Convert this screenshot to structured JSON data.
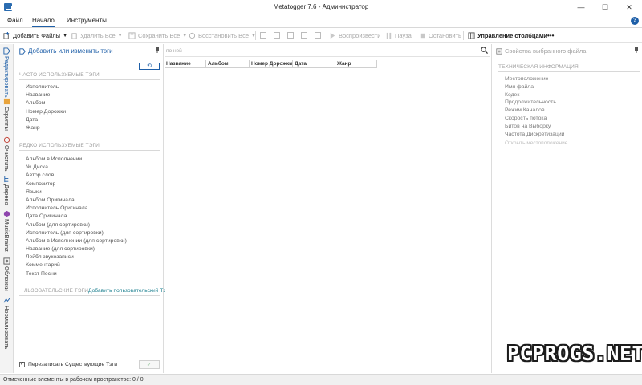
{
  "window": {
    "title": "Metatogger 7.6 - Администратор",
    "minimize_label": "—",
    "maximize_label": "☐",
    "close_label": "✕"
  },
  "menu": {
    "file": "Файл",
    "home": "Начало",
    "tools": "Инструменты",
    "help": "?"
  },
  "toolbar": {
    "add_files": "Добавить Файлы",
    "remove_all": "Удалить Всё",
    "save_all": "Сохранить Всё",
    "restore_all": "Восстановить Всё",
    "play": "Воспроизвести",
    "pause": "Пауза",
    "stop": "Остановить",
    "manage_columns": "Управление столбцами",
    "more": "•••"
  },
  "sidebar_tabs": [
    "Редактировать",
    "Скрипты",
    "Очистить",
    "Дерево",
    "MusicBrainz",
    "Обложки",
    "Нормализовать"
  ],
  "left_panel": {
    "title": "Добавить или изменить тэги",
    "refresh_label": "⟲",
    "frequent_header": "ЧАСТО ИСПОЛЬЗУЕМЫЕ ТЭГИ",
    "frequent_tags": [
      "Исполнитель",
      "Название",
      "Альбом",
      "Номер Дорожки",
      "Дата",
      "Жанр"
    ],
    "rare_header": "РЕДКО ИСПОЛЬЗУЕМЫЕ ТЭГИ",
    "rare_tags": [
      "Альбом в Исполнении",
      "№ Диска",
      "Автор слов",
      "Композитор",
      "Языки",
      "Альбом Оригинала",
      "Исполнитель Оригинала",
      "Дата Оригинала",
      "Альбом (для сортировки)",
      "Исполнитель (для сортировки)",
      "Альбом в Исполнении (для сортировки)",
      "Название (для сортировки)",
      "Лейбл звукозаписи",
      "Комментарий",
      "Текст Песни"
    ],
    "custom_header": "ЛЬЗОВАТЕЛЬСКИЕ ТЭГИ",
    "add_custom_tag": "Добавить пользовательский Тэг",
    "overwrite_label": "Перезаписать Существующие Тэги",
    "overwrite_checked": true,
    "apply_label": "✓"
  },
  "center": {
    "search_placeholder": "по ней",
    "columns": [
      "Название",
      "Альбом",
      "Номер Дорожки",
      "Дата",
      "Жанр"
    ]
  },
  "right_panel": {
    "title": "Свойства выбранного файла",
    "tech_header": "ТЕХНИЧЕСКАЯ ИНФОРМАЦИЯ",
    "properties": [
      "Местоположение",
      "Имя файла",
      "Кодек",
      "Продолжительность",
      "Режим Каналов",
      "Скорость потока",
      "Битов на Выборку",
      "Частота Дискретизации"
    ],
    "open_location": "Открыть местоположение..."
  },
  "status": {
    "text": "Отмеченные элементы в рабочем пространстве: 0 / 0"
  },
  "watermark": "PCPROGS.NET",
  "colors": {
    "accent": "#1e5fa8",
    "teal_link": "#1e8090"
  }
}
